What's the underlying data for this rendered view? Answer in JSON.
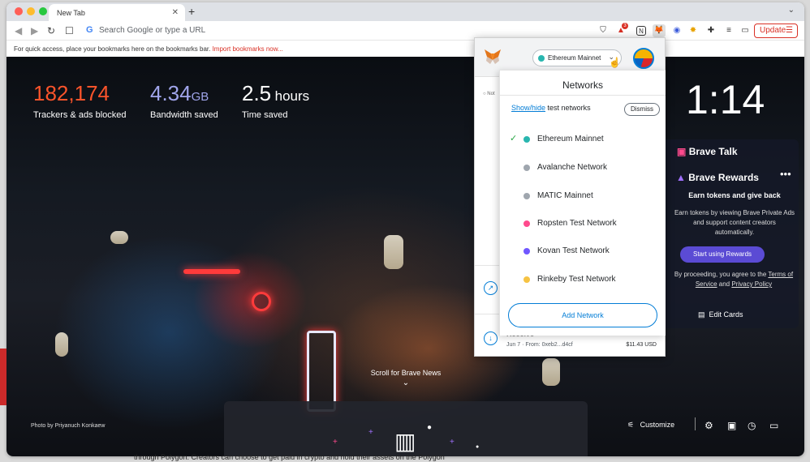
{
  "browser": {
    "tab_title": "New Tab",
    "tab_close": "✕",
    "new_tab": "+",
    "omnibox_placeholder": "Search Google or type a URL",
    "update_label": "Update",
    "bookmarks_bar_text": "For quick access, place your bookmarks here on the bookmarks bar.",
    "bookmarks_import_link": "Import bookmarks now...",
    "ext_badge": "3"
  },
  "stats": [
    {
      "value": "182,174",
      "unit": "",
      "label": "Trackers & ads blocked",
      "color": "#fb542b"
    },
    {
      "value": "4.34",
      "unit": "GB",
      "label": "Bandwidth saved",
      "color": "#a0a5eb"
    },
    {
      "value": "2.5",
      "unit": "hours",
      "label": "Time saved",
      "color": "#ffffff"
    }
  ],
  "clock": "1:14",
  "brave_talk": "Brave Talk",
  "rewards": {
    "title": "Brave Rewards",
    "menu": "•••",
    "subtitle": "Earn tokens and give back",
    "body": "Earn tokens by viewing Brave Private Ads and support content creators automatically.",
    "button": "Start using Rewards",
    "legal_prefix": "By proceeding, you agree to the",
    "terms": "Terms of Service",
    "and": "and",
    "privacy": "Privacy Policy"
  },
  "edit_cards": "Edit Cards",
  "scroll_news": "Scroll for Brave News",
  "photo_credit": "Photo by Priyanuch Konkaew",
  "customize": "Customize",
  "below_text": "through Polygon. Creators can choose to get paid in crypto and hold their assets on the Polygon",
  "metamask": {
    "network_pill": "Ethereum Mainnet",
    "bg_row_label": "Not",
    "footer_title": "Receive",
    "footer_meta": "Jun 7 · From: 0xeb2...d4cf",
    "footer_amount": "$11.43 USD",
    "networks_title": "Networks",
    "show_hide": "Show/hide",
    "test_networks": "test networks",
    "dismiss": "Dismiss",
    "networks": [
      {
        "name": "Ethereum Mainnet",
        "color": "#29b6af",
        "selected": true
      },
      {
        "name": "Avalanche Network",
        "color": "#9fa6ae",
        "selected": false
      },
      {
        "name": "MATIC Mainnet",
        "color": "#9fa6ae",
        "selected": false
      },
      {
        "name": "Ropsten Test Network",
        "color": "#ff4a8d",
        "selected": false
      },
      {
        "name": "Kovan Test Network",
        "color": "#7057ff",
        "selected": false
      },
      {
        "name": "Rinkeby Test Network",
        "color": "#f6c343",
        "selected": false
      }
    ],
    "add_network": "Add Network"
  }
}
